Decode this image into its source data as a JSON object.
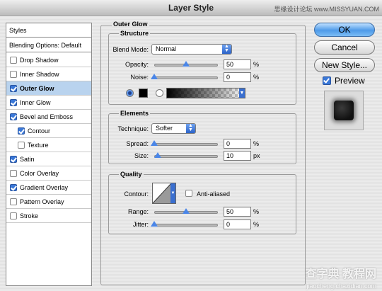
{
  "window": {
    "title": "Layer Style",
    "watermark_top": "思缘设计论坛 www.MISSYUAN.COM"
  },
  "left_list": {
    "styles_label": "Styles",
    "blending_label": "Blending Options: Default",
    "items": [
      {
        "label": "Drop Shadow",
        "checked": false
      },
      {
        "label": "Inner Shadow",
        "checked": false
      },
      {
        "label": "Outer Glow",
        "checked": true,
        "selected": true
      },
      {
        "label": "Inner Glow",
        "checked": true
      },
      {
        "label": "Bevel and Emboss",
        "checked": true
      },
      {
        "label": "Contour",
        "checked": true,
        "indent": true
      },
      {
        "label": "Texture",
        "checked": false,
        "indent": true
      },
      {
        "label": "Satin",
        "checked": true
      },
      {
        "label": "Color Overlay",
        "checked": false
      },
      {
        "label": "Gradient Overlay",
        "checked": true
      },
      {
        "label": "Pattern Overlay",
        "checked": false
      },
      {
        "label": "Stroke",
        "checked": false
      }
    ]
  },
  "outer_glow": {
    "section_title": "Outer Glow",
    "structure": {
      "title": "Structure",
      "blend_mode_label": "Blend Mode:",
      "blend_mode_value": "Normal",
      "opacity_label": "Opacity:",
      "opacity_value": "50",
      "opacity_level": 0.5,
      "noise_label": "Noise:",
      "noise_value": "0",
      "noise_level": 0.0,
      "percent": "%",
      "glow_color": "#000000"
    },
    "elements": {
      "title": "Elements",
      "technique_label": "Technique:",
      "technique_value": "Softer",
      "spread_label": "Spread:",
      "spread_value": "0",
      "spread_level": 0.0,
      "size_label": "Size:",
      "size_value": "10",
      "size_level": 0.05,
      "px": "px",
      "percent": "%"
    },
    "quality": {
      "title": "Quality",
      "contour_label": "Contour:",
      "anti_aliased_label": "Anti-aliased",
      "anti_aliased_checked": false,
      "range_label": "Range:",
      "range_value": "50",
      "range_level": 0.5,
      "jitter_label": "Jitter:",
      "jitter_value": "0",
      "jitter_level": 0.0,
      "percent": "%"
    }
  },
  "buttons": {
    "ok": "OK",
    "cancel": "Cancel",
    "new_style": "New Style...",
    "preview_label": "Preview",
    "preview_checked": true
  },
  "watermark_bottom": {
    "main": "查字典 教程网",
    "sub": "jiaocheng.chazidian.com"
  },
  "colors": {
    "accent": "#3a78d8",
    "selected_row": "#b9d3ee"
  }
}
